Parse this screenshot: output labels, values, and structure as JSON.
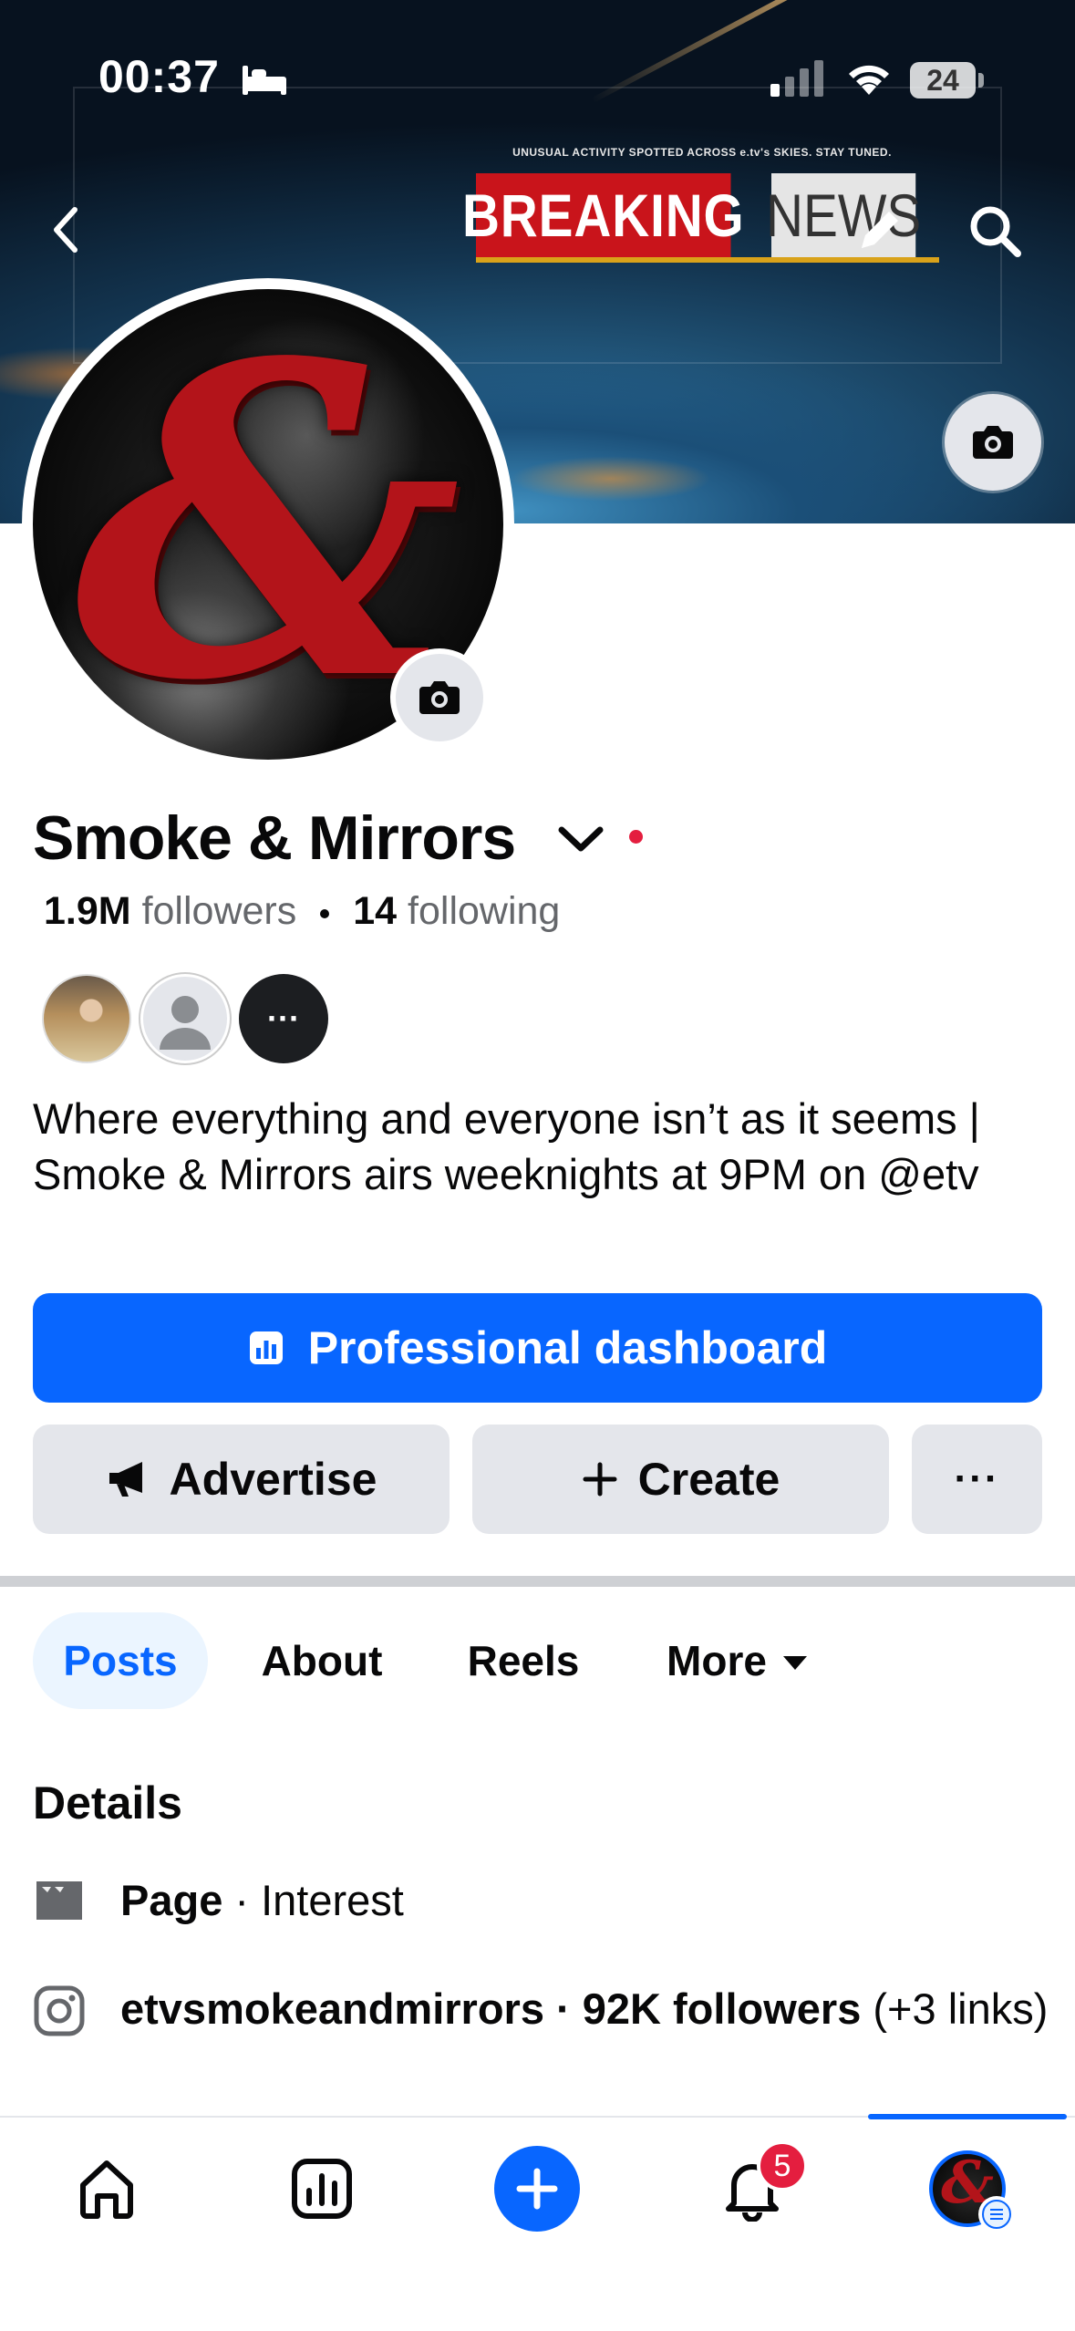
{
  "status_bar": {
    "time": "00:37",
    "battery": "24"
  },
  "cover": {
    "banner_tagline": "UNUSUAL ACTIVITY SPOTTED ACROSS e.tv's SKIES. STAY TUNED.",
    "banner_word1": "BREAKING",
    "banner_word2": "NEWS"
  },
  "profile": {
    "name": "Smoke & Mirrors",
    "followers_count": "1.9M",
    "followers_label": "followers",
    "following_count": "14",
    "following_label": "following",
    "more_avatars": "···",
    "bio": "Where everything and everyone isn’t as it seems | Smoke & Mirrors airs weeknights at 9PM on @etv"
  },
  "actions": {
    "primary": "Professional dashboard",
    "advertise": "Advertise",
    "create": "Create",
    "more": "···"
  },
  "tabs": [
    {
      "label": "Posts",
      "active": true
    },
    {
      "label": "About",
      "active": false
    },
    {
      "label": "Reels",
      "active": false
    },
    {
      "label": "More",
      "active": false
    }
  ],
  "details": {
    "title": "Details",
    "page_type_bold": "Page",
    "page_type_rest": " · Interest",
    "instagram_bold": "etvsmokeandmirrors · 92K followers",
    "instagram_rest": " (+3 links)"
  },
  "bottom_nav": {
    "notifications_badge": "5",
    "items": [
      "home-icon",
      "dashboard-icon",
      "create-icon",
      "bell-icon",
      "profile-avatar"
    ]
  },
  "colors": {
    "accent": "#0866ff",
    "secondary_button": "#e4e6eb",
    "badge_red": "#e41e3f",
    "tab_active_bg": "#ebf5ff"
  }
}
